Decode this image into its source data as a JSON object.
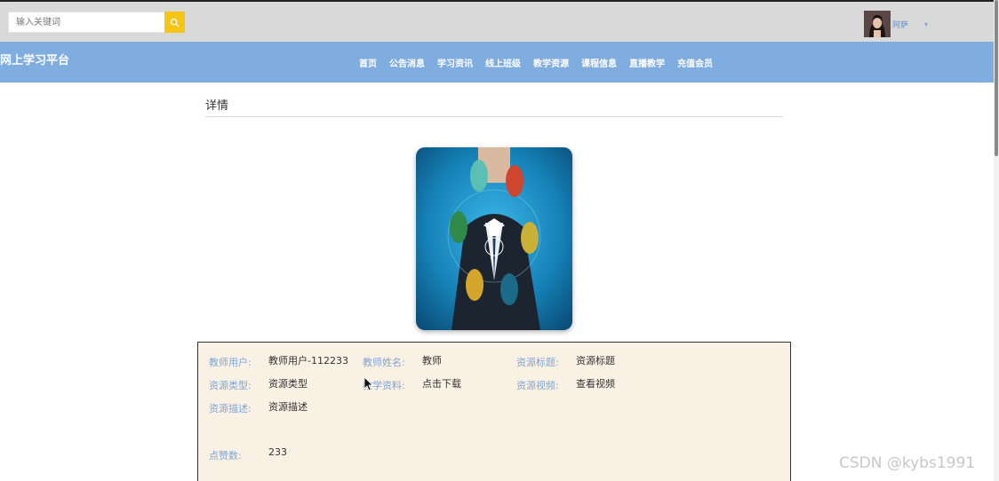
{
  "search": {
    "placeholder": "输入关键词"
  },
  "user": {
    "name": "阿萨"
  },
  "site": {
    "title": "网上学习平台"
  },
  "nav": {
    "items": [
      "首页",
      "公告消息",
      "学习资讯",
      "线上班级",
      "教学资源",
      "课程信息",
      "直播教学",
      "充值会员"
    ]
  },
  "detail": {
    "section_title": "详情",
    "fields": {
      "teacher_user": {
        "label": "教师用户:",
        "value": "教师用户-112233"
      },
      "teacher_name": {
        "label": "教师姓名:",
        "value": "教师"
      },
      "resource_title": {
        "label": "资源标题:",
        "value": "资源标题"
      },
      "resource_type": {
        "label": "资源类型:",
        "value": "资源类型"
      },
      "teaching_material": {
        "label": "教学资料:",
        "value": "点击下载"
      },
      "resource_video": {
        "label": "资源视频:",
        "value": "查看视频"
      },
      "resource_desc": {
        "label": "资源描述:",
        "value": "资源描述"
      },
      "likes": {
        "label": "点赞数:",
        "value": "233"
      }
    }
  },
  "watermark": "CSDN @kybs1991",
  "colors": {
    "topbar": "#d9d9d9",
    "navbar": "#7fade0",
    "search_button": "#f5c518",
    "label": "#7fa6d6",
    "info_bg": "#f8f1e4"
  }
}
